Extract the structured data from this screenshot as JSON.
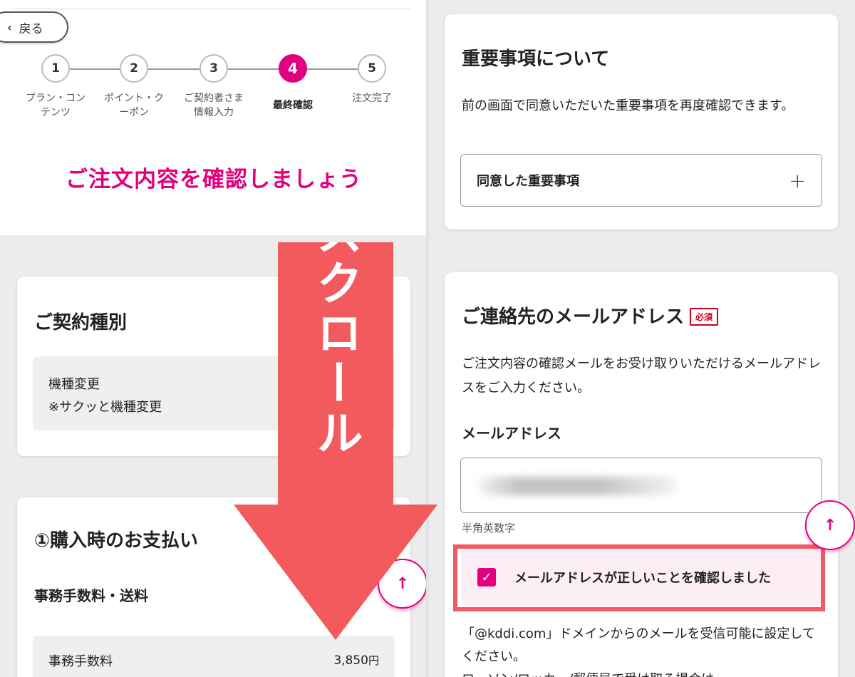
{
  "back_label": "戻る",
  "steps": [
    {
      "num": "1",
      "label": "プラン・コン\nテンツ"
    },
    {
      "num": "2",
      "label": "ポイント・ク\nーポン"
    },
    {
      "num": "3",
      "label": "ご契約者さま\n情報入力"
    },
    {
      "num": "4",
      "label": "最終確認"
    },
    {
      "num": "5",
      "label": "注文完了"
    }
  ],
  "page_title": "ご注文内容を確認しましょう",
  "contract_card": {
    "title": "ご契約種別",
    "line1": "機種変更",
    "line2": "※サクッと機種変更"
  },
  "payment_card": {
    "title": "①購入時のお支払い",
    "subtitle": "事務手数料・送料",
    "fee_label": "事務手数料",
    "fee_value": "3,850",
    "fee_unit": "円"
  },
  "important_card": {
    "title": "重要事項について",
    "description": "前の画面で同意いただいた重要事項を再度確認できます。",
    "accordion_label": "同意した重要事項",
    "plus": "+"
  },
  "email_card": {
    "title": "ご連絡先のメールアドレス",
    "required_badge": "必須",
    "description": "ご注文内容の確認メールをお受け取りいただけるメールアドレスをご入力ください。",
    "field_label": "メールアドレス",
    "hint": "半角英数字",
    "confirm_label": "メールアドレスが正しいことを確認しました",
    "note1": "「@kddi.com」ドメインからのメールを受信可能に設定してください。",
    "note2": "ローソン/ロッカー/郵便局で受け取る場合は"
  },
  "overlay": {
    "text": "下にスクロール",
    "color": "#f25a5e"
  },
  "scroll_top_icon": "↑",
  "accent_color": "#e2007e"
}
